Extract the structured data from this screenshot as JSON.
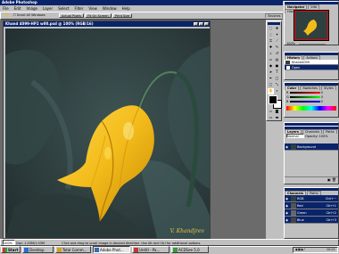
{
  "app": {
    "title": "Adobe Photoshop"
  },
  "menu": [
    "File",
    "Edit",
    "Image",
    "Layer",
    "Select",
    "Filter",
    "View",
    "Window",
    "Help"
  ],
  "options_bar": {
    "chk_label": "Scroll All Windows",
    "btn1": "Actual Pixels",
    "btn2": "Fit On Screen",
    "btn3": "Print Size",
    "tabs": [
      "Brushes",
      "Tool Presets",
      "Layer Comps"
    ]
  },
  "document": {
    "title": "Khand 4099-HP2 w00.psd @ 100% (RGB/16)",
    "signature": "V. Khandjrev"
  },
  "status_bar": {
    "zoom": "100%",
    "doc_size": "Doc: 1.03M/1.03M",
    "hint": "Click and drag to scroll image in desired direction. Use Alt and Ctrl for additional options."
  },
  "panels": {
    "navigator": {
      "tabs": [
        "Navigator",
        "Info",
        "Histogram"
      ],
      "zoom": "100%"
    },
    "history": {
      "tabs": [
        "History",
        "Actions"
      ],
      "items": [
        "Khand4099",
        "Open"
      ]
    },
    "color": {
      "tabs": [
        "Color",
        "Swatches",
        "Styles"
      ],
      "labels": [
        "R",
        "G",
        "B"
      ],
      "values": [
        "0",
        "0",
        "0"
      ]
    },
    "character": {
      "tabs": [
        "Character",
        "Paragraph"
      ]
    },
    "layers": {
      "tabs": [
        "Layers",
        "Channels",
        "Paths"
      ],
      "mode": "Normal",
      "opacity": "Opacity: 100%",
      "items": [
        "Background"
      ]
    },
    "channels": {
      "tabs": [
        "Channels",
        "Paths"
      ],
      "items": [
        "RGB",
        "Red",
        "Green",
        "Blue"
      ],
      "shortcuts": [
        "Ctrl+~",
        "Ctrl+1",
        "Ctrl+2",
        "Ctrl+3"
      ]
    }
  },
  "taskbar": {
    "start": "Start",
    "buttons": [
      "Desktop",
      "Total Comm...",
      "Adobe Phot...",
      "Untitl - Pa...",
      "ACDSee 5.0"
    ],
    "clock": "10:21"
  },
  "colors": {
    "title_bg": "#0a246a",
    "canvas_bg": "#6b6b6b",
    "petal": "#f2bb1a",
    "photo_bg": "#2e3f3f"
  }
}
